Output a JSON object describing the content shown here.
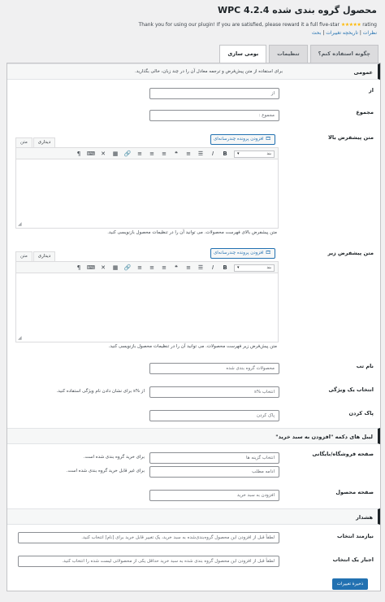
{
  "title": "محصول گروه بندی شده WPC 4.2.4",
  "thanks": "Thank you for using our plugin! If you are satisfied, please reward it a full five-star",
  "stars": "★★★★★",
  "rating": "rating",
  "links": {
    "reviews": "نظرات",
    "sep": " | ",
    "changelog": "تاریخچه تغییرات",
    "discuss": "بحث"
  },
  "tabs": [
    {
      "label": "چگونه استفاده کنم؟"
    },
    {
      "label": "تنظیمات"
    },
    {
      "label": "بومی سازی"
    }
  ],
  "general": {
    "heading": "عمومی",
    "note": "برای استفاده از متن پیش‌فرض و ترجمه معادل آن را در چند زبان، خالی بگذارید.",
    "from_label": "از",
    "from_placeholder": "از",
    "total_label": "مجموع",
    "total_placeholder": "مجموع :"
  },
  "above": {
    "label": "متن پیشفرض بالا",
    "media": "افزودن پرونده چندرسانه‌ای",
    "tab_visual": "دیداری",
    "tab_text": "متن",
    "format": "بند",
    "desc": "متن پیشفرض بالای فهرست محصولات. می توانید آن را در تنظیمات محصول بازنویسی کنید."
  },
  "below": {
    "label": "متن پیشفرض زیر",
    "media": "افزودن پرونده چندرسانه‌ای",
    "tab_visual": "دیداری",
    "tab_text": "متن",
    "format": "بند",
    "desc": "متن پیش‌فرض زیر فهرست محصولات. می توانید آن را در تنظیمات محصول بازنویسی کنید."
  },
  "toolbar_icons": [
    "B",
    "I",
    "☰",
    "≡",
    "❝",
    "≡",
    "≡",
    "≡",
    "🔗",
    "▦",
    "✕",
    "⌨",
    "¶"
  ],
  "tab_name": {
    "label": "نام تب",
    "placeholder": "محصولات گروه بندی شده"
  },
  "choose": {
    "label": "انتخاب یک ویژگی",
    "placeholder": "انتخاب %s",
    "desc": "از %s برای نشان دادن نام ویژگی استفاده کنید."
  },
  "clear": {
    "label": "پاک کردن",
    "placeholder": "پاک کردن"
  },
  "cart_section": {
    "heading": "لیبل های دکمه \"افزودن به سبد خرید\""
  },
  "archive": {
    "label": "صفحه فروشگاه/بایگانی",
    "field1_placeholder": "انتخاب گزینه ها",
    "field1_desc": "برای خرید گروه بندی شده است.",
    "field2_placeholder": "ادامه مطلب",
    "field2_desc": "برای غیر قابل خرید گروه بندی شده است."
  },
  "single": {
    "label": "صفحه محصول",
    "placeholder": "افزودن به سبد خرید"
  },
  "alert_section": {
    "heading": "هشدار"
  },
  "require": {
    "label": "نیازمند انتخاب",
    "placeholder": "لطفاً قبل از افزودن این محصول گروه‌بندی‌شده به سبد خرید، یک تغییر قابل خرید برای [نام] انتخاب کنید."
  },
  "force": {
    "label": "اجبار یک انتخاب",
    "placeholder": "لطفاً قبل از افزودن این محصول گروه بندی شده به سبد خرید حداقل یکی از محصولاتی لیست شده را انتخاب کنید."
  },
  "save_label": "ذخیرهٔ تغییرات"
}
